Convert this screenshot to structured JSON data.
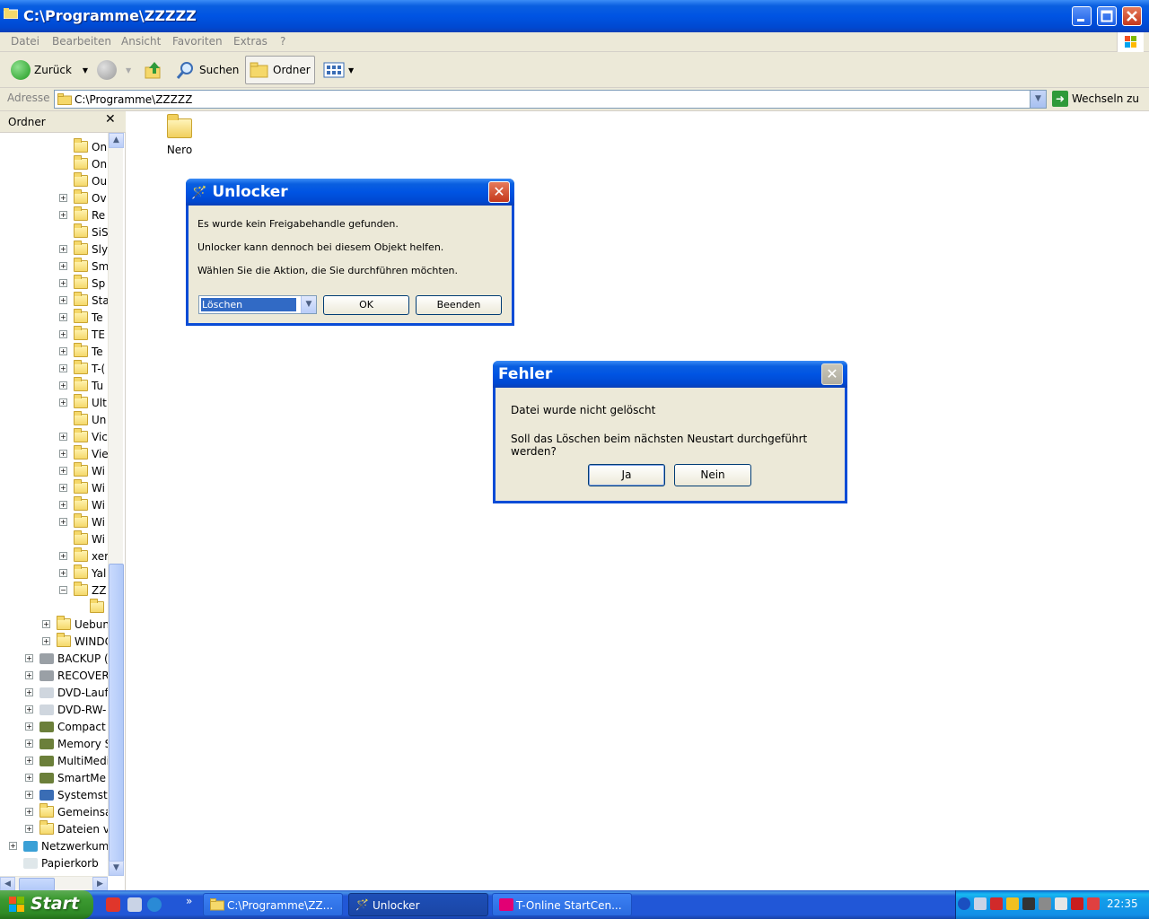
{
  "window": {
    "title": "C:\\Programme\\ZZZZZ",
    "buttons": [
      "minimize",
      "maximize",
      "close"
    ]
  },
  "menu": [
    "Datei",
    "Bearbeiten",
    "Ansicht",
    "Favoriten",
    "Extras",
    "?"
  ],
  "toolbar": {
    "back_label": "Zurück",
    "search_label": "Suchen",
    "folders_label": "Ordner"
  },
  "address": {
    "label": "Adresse",
    "value": "C:\\Programme\\ZZZZZ",
    "go_label": "Wechseln zu"
  },
  "folder_pane": {
    "title": "Ordner",
    "tree": [
      {
        "label": "On",
        "expander": "",
        "icon": "folder"
      },
      {
        "label": "On",
        "expander": "",
        "icon": "folder"
      },
      {
        "label": "Ou",
        "expander": "",
        "icon": "folder"
      },
      {
        "label": "Ov",
        "expander": "+",
        "icon": "folder"
      },
      {
        "label": "Re",
        "expander": "+",
        "icon": "folder"
      },
      {
        "label": "SiS",
        "expander": "",
        "icon": "folder"
      },
      {
        "label": "Sly",
        "expander": "+",
        "icon": "folder"
      },
      {
        "label": "Sm",
        "expander": "+",
        "icon": "folder"
      },
      {
        "label": "Sp",
        "expander": "+",
        "icon": "folder"
      },
      {
        "label": "Sta",
        "expander": "+",
        "icon": "folder"
      },
      {
        "label": "Te",
        "expander": "+",
        "icon": "folder"
      },
      {
        "label": "TE",
        "expander": "+",
        "icon": "folder"
      },
      {
        "label": "Te",
        "expander": "+",
        "icon": "folder"
      },
      {
        "label": "T-(",
        "expander": "+",
        "icon": "folder"
      },
      {
        "label": "Tu",
        "expander": "+",
        "icon": "folder"
      },
      {
        "label": "Ult",
        "expander": "+",
        "icon": "folder"
      },
      {
        "label": "Un",
        "expander": "",
        "icon": "folder"
      },
      {
        "label": "Vic",
        "expander": "+",
        "icon": "folder"
      },
      {
        "label": "Vie",
        "expander": "+",
        "icon": "folder"
      },
      {
        "label": "Wi",
        "expander": "+",
        "icon": "folder"
      },
      {
        "label": "Wi",
        "expander": "+",
        "icon": "folder"
      },
      {
        "label": "Wi",
        "expander": "+",
        "icon": "folder"
      },
      {
        "label": "Wi",
        "expander": "+",
        "icon": "folder"
      },
      {
        "label": "Wi",
        "expander": "",
        "icon": "folder"
      },
      {
        "label": "xer",
        "expander": "+",
        "icon": "folder"
      },
      {
        "label": "Yal",
        "expander": "+",
        "icon": "folder"
      },
      {
        "label": "ZZ",
        "expander": "−",
        "icon": "folder"
      },
      {
        "label": "",
        "expander": "",
        "icon": "folder"
      },
      {
        "label": "Uebun",
        "expander": "+",
        "icon": "folder"
      },
      {
        "label": "WINDO",
        "expander": "+",
        "icon": "folder"
      },
      {
        "label": "BACKUP (",
        "expander": "+",
        "icon": "drive"
      },
      {
        "label": "RECOVER",
        "expander": "+",
        "icon": "drive"
      },
      {
        "label": "DVD-Lauf",
        "expander": "+",
        "icon": "dvd"
      },
      {
        "label": "DVD-RW-",
        "expander": "+",
        "icon": "dvd"
      },
      {
        "label": "Compact",
        "expander": "+",
        "icon": "card"
      },
      {
        "label": "Memory S",
        "expander": "+",
        "icon": "card"
      },
      {
        "label": "MultiMedi",
        "expander": "+",
        "icon": "card"
      },
      {
        "label": "SmartMe",
        "expander": "+",
        "icon": "card"
      },
      {
        "label": "Systemst",
        "expander": "+",
        "icon": "control"
      },
      {
        "label": "Gemeinsa",
        "expander": "+",
        "icon": "folder"
      },
      {
        "label": "Dateien v",
        "expander": "+",
        "icon": "folder"
      },
      {
        "label": "Netzwerkumg",
        "expander": "+",
        "icon": "network"
      },
      {
        "label": "Papierkorb",
        "expander": "",
        "icon": "recycle"
      }
    ]
  },
  "content": {
    "items": [
      {
        "label": "Nero"
      }
    ]
  },
  "unlocker_dialog": {
    "title": "Unlocker",
    "line1": "Es wurde kein Freigabehandle gefunden.",
    "line2": "Unlocker kann dennoch bei diesem Objekt helfen.",
    "line3": "Wählen Sie die Aktion, die Sie durchführen möchten.",
    "action_selected": "Löschen",
    "ok_label": "OK",
    "quit_label": "Beenden"
  },
  "error_dialog": {
    "title": "Fehler",
    "line1": "Datei wurde nicht gelöscht",
    "line2": "Soll das Löschen beim nächsten Neustart durchgeführt werden?",
    "yes_label": "Ja",
    "no_label": "Nein"
  },
  "taskbar": {
    "start_label": "Start",
    "quicklaunch_more": "»",
    "tasks": [
      {
        "label": "C:\\Programme\\ZZ...",
        "active": false
      },
      {
        "label": "Unlocker",
        "active": true
      },
      {
        "label": "T-Online StartCen...",
        "active": false
      }
    ],
    "clock": "22:35"
  },
  "colors": {
    "xp_blue": "#0054e3",
    "dialog_bg": "#ece9d8",
    "start_green": "#3c9a31",
    "selection": "#316ac5"
  }
}
